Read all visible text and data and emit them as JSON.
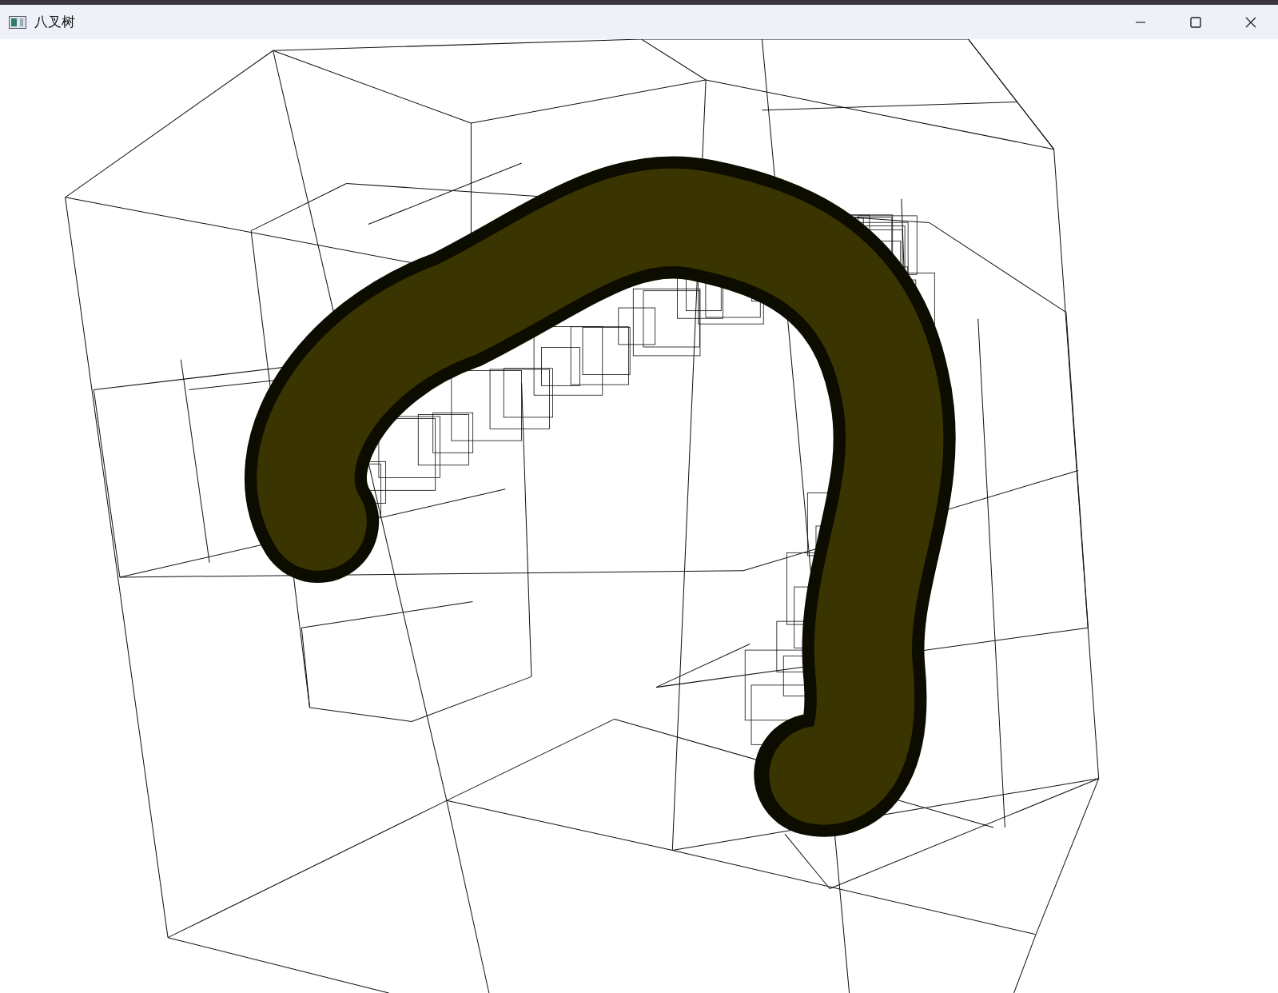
{
  "window": {
    "title": "八叉树"
  }
}
